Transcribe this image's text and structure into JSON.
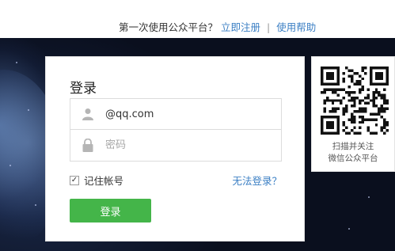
{
  "header": {
    "question": "第一次使用公众平台？",
    "register_link": "立即注册",
    "separator": "|",
    "help_link": "使用帮助"
  },
  "login": {
    "title": "登录",
    "account_value": "@qq.com",
    "password_placeholder": "密码",
    "remember_label": "记住帐号",
    "remember_checked": true,
    "forgot_link": "无法登录？",
    "submit_label": "登录"
  },
  "qr": {
    "caption_line1": "扫描并关注",
    "caption_line2": "微信公众平台"
  },
  "colors": {
    "link": "#3b7fc4",
    "button": "#44b549",
    "background": "#0b1120"
  }
}
